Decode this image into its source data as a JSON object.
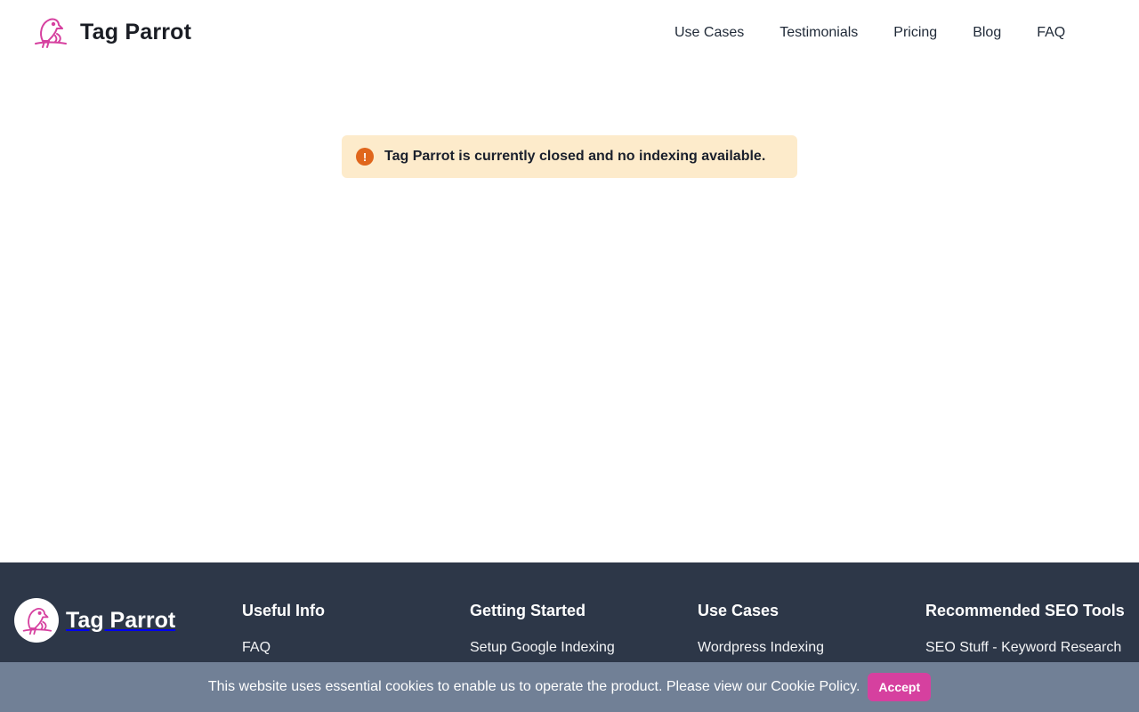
{
  "brand": {
    "name": "Tag Parrot",
    "logo_icon": "parrot-icon",
    "accent_color": "#d6409f"
  },
  "nav": {
    "items": [
      {
        "label": "Use Cases"
      },
      {
        "label": "Testimonials"
      },
      {
        "label": "Pricing"
      },
      {
        "label": "Blog"
      },
      {
        "label": "FAQ"
      }
    ]
  },
  "alert": {
    "icon": "exclamation-circle-icon",
    "icon_glyph": "!",
    "message": "Tag Parrot is currently closed and no indexing available.",
    "background_color": "#fdebcb",
    "icon_color": "#e0661c"
  },
  "footer": {
    "brand_name": "Tag Parrot",
    "background_color": "#2d3748",
    "columns": [
      {
        "title": "Useful Info",
        "links": [
          "FAQ"
        ]
      },
      {
        "title": "Getting Started",
        "links": [
          "Setup Google Indexing"
        ]
      },
      {
        "title": "Use Cases",
        "links": [
          "Wordpress Indexing"
        ]
      },
      {
        "title": "Recommended SEO Tools",
        "links": [
          "SEO Stuff - Keyword Research"
        ]
      }
    ]
  },
  "cookie_banner": {
    "message": "This website uses essential cookies to enable us to operate the product. Please view our Cookie Policy.",
    "accept_label": "Accept",
    "background_color": "#718096"
  }
}
